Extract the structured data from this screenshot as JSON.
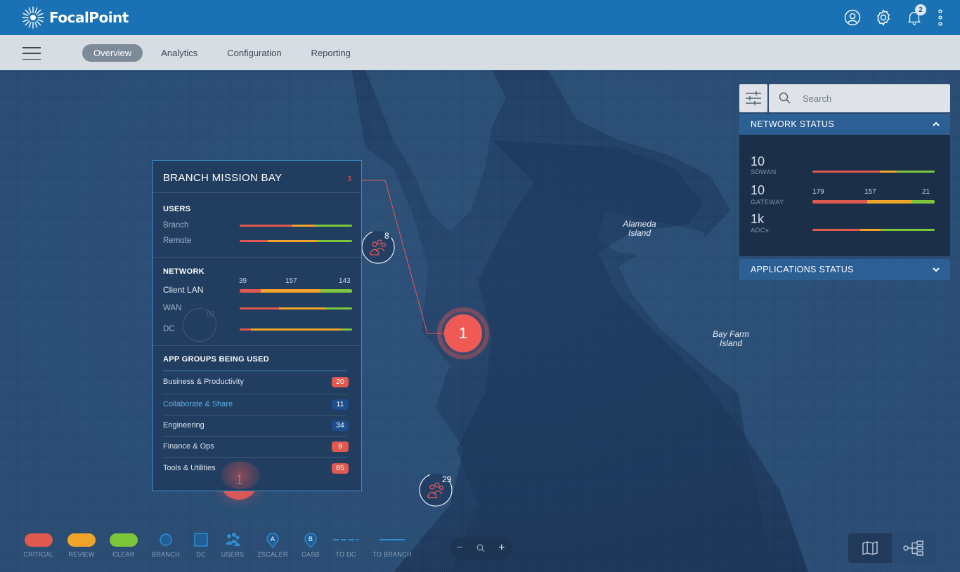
{
  "app": {
    "name": "FocalPoint",
    "notifications_count": "2"
  },
  "nav": {
    "tabs": [
      {
        "label": "Overview",
        "active": true
      },
      {
        "label": "Analytics",
        "active": false
      },
      {
        "label": "Configuration",
        "active": false
      },
      {
        "label": "Reporting",
        "active": false
      }
    ]
  },
  "map": {
    "labels": {
      "alameda": "Alameda Island",
      "bay_farm": "Bay Farm Island"
    },
    "markers": {
      "users_top": "8",
      "users_bottom": "29",
      "users_faint": "07",
      "alert_main": "1",
      "alert_faint": "1"
    }
  },
  "branch": {
    "title": "BRANCH MISSION BAY",
    "count": "3",
    "users": {
      "title": "USERS",
      "rows": [
        {
          "label": "Branch",
          "segments": [
            {
              "color": "#e0594f",
              "pct": 46
            },
            {
              "color": "#f0a429",
              "pct": 22
            },
            {
              "color": "#7dc63b",
              "pct": 32
            }
          ]
        },
        {
          "label": "Remote",
          "segments": [
            {
              "color": "#e0594f",
              "pct": 25
            },
            {
              "color": "#f0a429",
              "pct": 44
            },
            {
              "color": "#7dc63b",
              "pct": 31
            }
          ]
        }
      ]
    },
    "network": {
      "title": "NETWORK",
      "rows": [
        {
          "label": "Client LAN",
          "values": [
            "39",
            "157",
            "143"
          ],
          "segments": [
            {
              "color": "#e0594f",
              "pct": 19
            },
            {
              "color": "#f0a429",
              "pct": 53
            },
            {
              "color": "#7dc63b",
              "pct": 28
            }
          ]
        },
        {
          "label": "WAN",
          "segments": [
            {
              "color": "#e0594f",
              "pct": 35
            },
            {
              "color": "#f0a429",
              "pct": 42
            },
            {
              "color": "#7dc63b",
              "pct": 23
            }
          ]
        },
        {
          "label": "DC",
          "segments": [
            {
              "color": "#e0594f",
              "pct": 10
            },
            {
              "color": "#f0a429",
              "pct": 80
            },
            {
              "color": "#7dc63b",
              "pct": 10
            }
          ]
        }
      ]
    },
    "app_groups": {
      "title": "APP GROUPS BEING USED",
      "items": [
        {
          "label": "Business & Productivity",
          "count": "20",
          "color": "#e0594f"
        },
        {
          "label": "Collaborate & Share",
          "count": "11",
          "color": "#1f4e8c"
        },
        {
          "label": "Engineering",
          "count": "34",
          "color": "#1f4e8c"
        },
        {
          "label": "Finance & Ops",
          "count": "9",
          "color": "#e0594f"
        },
        {
          "label": "Tools & Utilities",
          "count": "85",
          "color": "#e0594f"
        }
      ]
    }
  },
  "search": {
    "placeholder": "Search"
  },
  "network_status": {
    "title": "NETWORK STATUS",
    "rows": [
      {
        "value": "10",
        "label": "SDWAN",
        "segments": [
          {
            "color": "#e0594f",
            "pct": 55
          },
          {
            "color": "#f0a429",
            "pct": 14
          },
          {
            "color": "#7dc63b",
            "pct": 31
          }
        ]
      },
      {
        "value": "10",
        "label": "GATEWAY",
        "values": [
          "179",
          "157",
          "21"
        ],
        "segments": [
          {
            "color": "#e0594f",
            "pct": 45
          },
          {
            "color": "#f0a429",
            "pct": 36
          },
          {
            "color": "#7dc63b",
            "pct": 19
          }
        ]
      },
      {
        "value": "1k",
        "label": "ADCs",
        "segments": [
          {
            "color": "#e0594f",
            "pct": 39
          },
          {
            "color": "#f0a429",
            "pct": 17
          },
          {
            "color": "#7dc63b",
            "pct": 44
          }
        ]
      }
    ]
  },
  "applications_status": {
    "title": "APPLICATIONS STATUS"
  },
  "legend": [
    {
      "label": "CRITICAL",
      "kind": "pill",
      "color": "#e0594f"
    },
    {
      "label": "REVIEW",
      "kind": "pill",
      "color": "#f0a429"
    },
    {
      "label": "CLEAR",
      "kind": "pill",
      "color": "#7dc63b"
    },
    {
      "label": "BRANCH",
      "kind": "circle",
      "color": "#2e8fd0"
    },
    {
      "label": "DC",
      "kind": "square",
      "color": "#2e8fd0"
    },
    {
      "label": "USERS",
      "kind": "users",
      "color": "#2e8fd0"
    },
    {
      "label": "ZSCALER",
      "kind": "pin",
      "color": "#2e8fd0",
      "letter": "A"
    },
    {
      "label": "CASB",
      "kind": "pin",
      "color": "#2e8fd0",
      "letter": "B"
    },
    {
      "label": "TO DC",
      "kind": "dashed",
      "color": "#2e8fd0"
    },
    {
      "label": "TO BRANCH",
      "kind": "solid",
      "color": "#2e8fd0"
    }
  ],
  "zoom": {
    "minus": "−",
    "plus": "+"
  }
}
